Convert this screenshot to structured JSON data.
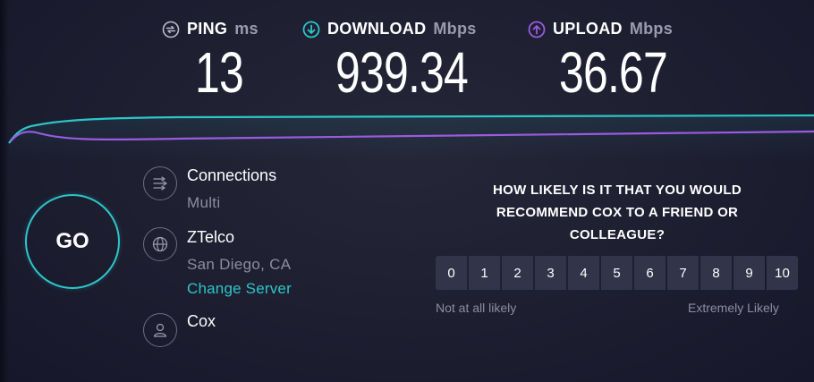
{
  "results": {
    "ping": {
      "label": "PING",
      "unit": "ms",
      "value": "13",
      "icon": "ping-icon"
    },
    "download": {
      "label": "DOWNLOAD",
      "unit": "Mbps",
      "value": "939.34",
      "icon": "download-arrow-icon"
    },
    "upload": {
      "label": "UPLOAD",
      "unit": "Mbps",
      "value": "36.67",
      "icon": "upload-arrow-icon"
    }
  },
  "colors": {
    "download": "#2cc6c9",
    "upload": "#9a5be0",
    "background": "#1d1e30",
    "scale_button": "#32344a"
  },
  "go_button": {
    "label": "GO"
  },
  "connections": {
    "title": "Connections",
    "value": "Multi",
    "icon": "connections-arrows-icon"
  },
  "server": {
    "name": "ZTelco",
    "location": "San Diego, CA",
    "change_label": "Change Server",
    "icon": "globe-icon"
  },
  "provider": {
    "name": "Cox",
    "icon": "user-icon"
  },
  "survey": {
    "question": "HOW LIKELY IS IT THAT YOU WOULD RECOMMEND COX TO A FRIEND OR COLLEAGUE?",
    "scale": [
      "0",
      "1",
      "2",
      "3",
      "4",
      "5",
      "6",
      "7",
      "8",
      "9",
      "10"
    ],
    "low_label": "Not at all likely",
    "high_label": "Extremely Likely"
  }
}
